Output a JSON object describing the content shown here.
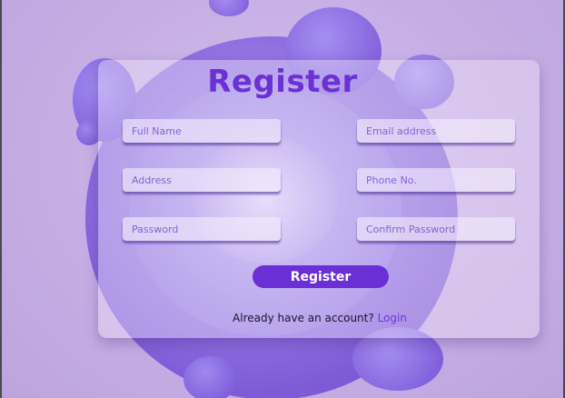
{
  "form": {
    "title": "Register",
    "fields": {
      "full_name": {
        "placeholder": "Full Name",
        "value": ""
      },
      "email": {
        "placeholder": "Email address",
        "value": ""
      },
      "address": {
        "placeholder": "Address",
        "value": ""
      },
      "phone": {
        "placeholder": "Phone No.",
        "value": ""
      },
      "password": {
        "placeholder": "Password",
        "value": ""
      },
      "confirm_password": {
        "placeholder": "Confirm Password",
        "value": ""
      }
    },
    "submit_label": "Register",
    "account_prompt": "Already have an account?",
    "login_label": "Login"
  },
  "colors": {
    "accent": "#6b2fd6",
    "title": "#6a32d4",
    "background": "#c9b2e6"
  }
}
